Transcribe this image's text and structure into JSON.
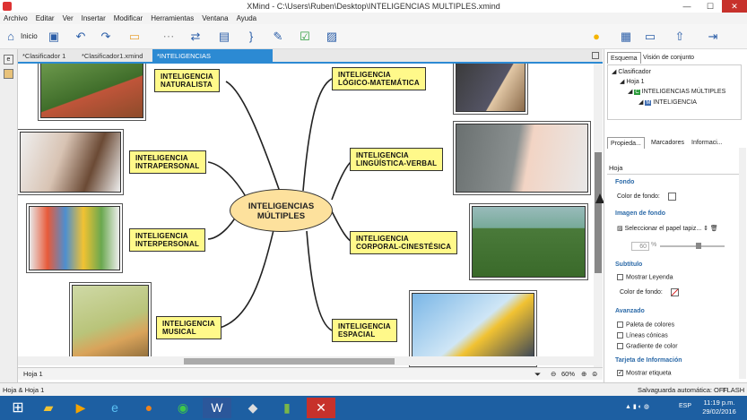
{
  "window": {
    "title": "XMind - C:\\Users\\Ruben\\Desktop\\INTELIGENCIAS MULTIPLES.xmind",
    "minimize": "—",
    "maximize": "☐",
    "close": "✕"
  },
  "menu": [
    "Archivo",
    "Editar",
    "Ver",
    "Insertar",
    "Modificar",
    "Herramientas",
    "Ventana",
    "Ayuda"
  ],
  "toolbar": {
    "home_label": "Inicio"
  },
  "tabs": [
    {
      "label": "*Clasificador 1"
    },
    {
      "label": "*Clasificador1.xmind"
    },
    {
      "label": "*INTELIGENCIAS MULTIPLES.xmind"
    }
  ],
  "tab_close": "✕",
  "mindmap": {
    "central": "INTELIGENCIAS\nMÚLTIPLES",
    "topics": {
      "naturalista": "INTELIGENCIA\nNATURALISTA",
      "logico": "INTELIGENCIA\nLÓGICO-MATEMÁTICA",
      "intrapersonal": "INTELIGENCIA\nINTRAPERSONAL",
      "linguistica": "INTELIGENCIA\nLINGÜÍSTICA-VERBAL",
      "interpersonal": "INTELIGENCIA\nINTERPERSONAL",
      "corporal": "INTELIGENCIA\nCORPORAL-CINESTÉSICA",
      "musical": "INTELIGENCIA\nMUSICAL",
      "espacial": "INTELIGENCIA\nESPACIAL"
    }
  },
  "sheet_bar": {
    "sheet": "Hoja 1",
    "zoom": "60%"
  },
  "right_panel": {
    "top_tabs": [
      "Esquema",
      "Visión de conjunto"
    ],
    "outline": [
      "Clasificador",
      "Hoja 1",
      "INTELIGENCIAS MÚLTIPLES",
      "INTELIGENCIA"
    ],
    "prop_tabs": [
      "Propieda...",
      "Marcadores",
      "Informaci..."
    ],
    "heading": "Hoja",
    "fondo": "Fondo",
    "color_fondo": "Color de fondo:",
    "imagen_fondo": "Imagen de fondo",
    "select_wallpaper": "Seleccionar el papel tapiz...",
    "opacity": "60",
    "percent": "%",
    "subtitulo": "Subtítulo",
    "mostrar_leyenda": "Mostrar Leyenda",
    "color_fondo2": "Color de fondo:",
    "avanzado": "Avanzado",
    "paleta": "Paleta de colores",
    "lineas": "Líneas cónicas",
    "gradiente": "Gradiente de color",
    "tarjeta": "Tarjeta de Información",
    "mostrar_etiqueta": "Mostrar etiqueta"
  },
  "status": {
    "left": "Hoja & Hoja 1",
    "right": "Salvaguarda automática: OFF",
    "flash": "FLASH"
  },
  "taskbar": {
    "lang": "ESP",
    "time": "11:19 p.m.",
    "date": "29/02/2016"
  },
  "colors": {
    "topic_fill": "#fff98a",
    "central_fill": "#fde19d",
    "accent": "#2c8ad3",
    "taskbar": "#1d5fa2"
  }
}
